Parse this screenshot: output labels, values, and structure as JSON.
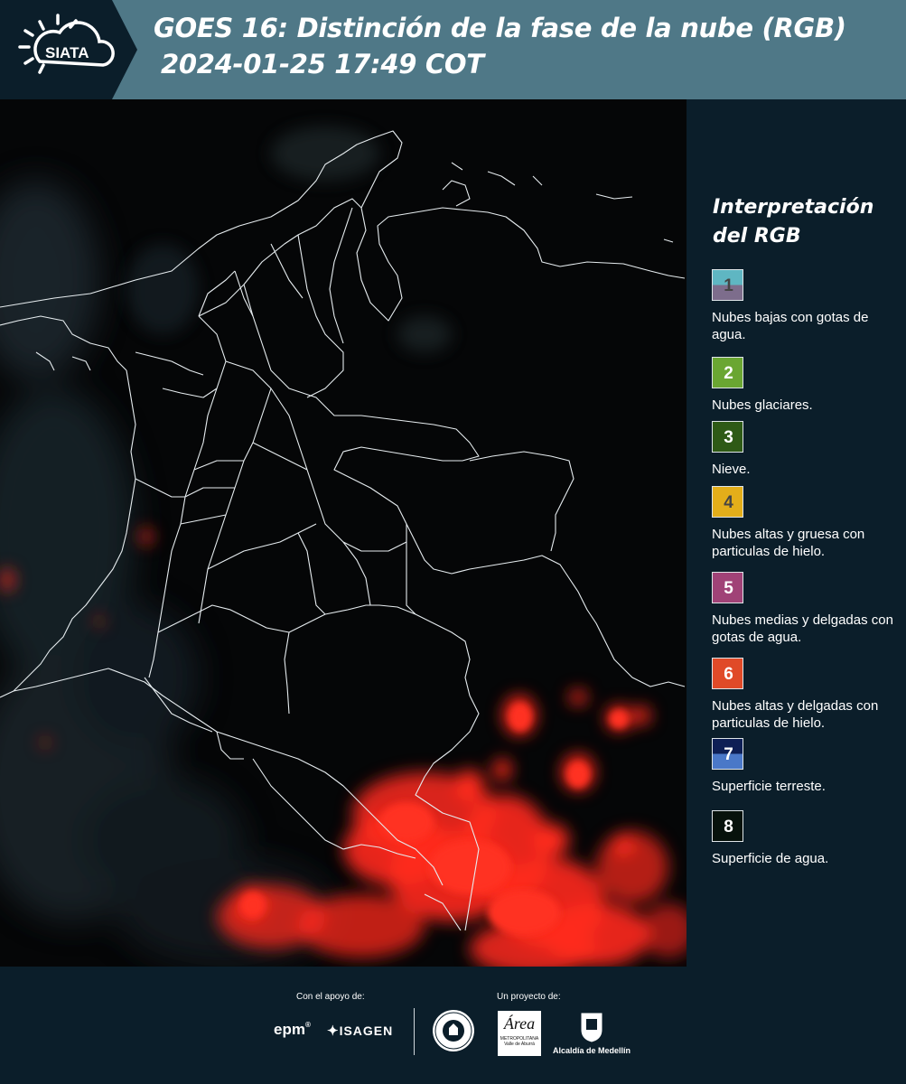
{
  "header": {
    "logo_text": "SIATA",
    "title_line1": "GOES 16: Distinción de la fase de la nube (RGB)",
    "title_line2": "2024-01-25 17:49 COT"
  },
  "legend": {
    "title": "Interpretación del RGB",
    "items": [
      {
        "num": "1",
        "label": "Nubes bajas con gotas de agua.",
        "color_top": "#5fb6c2",
        "color_bottom": "#7d6d8c",
        "num_color": "#444444"
      },
      {
        "num": "2",
        "label": "Nubes glaciares.",
        "color_top": "#6aa632",
        "color_bottom": "#6aa632",
        "num_color": "#ffffff"
      },
      {
        "num": "3",
        "label": "Nieve.",
        "color_top": "#2e5a16",
        "color_bottom": "#2e5a16",
        "num_color": "#ffffff"
      },
      {
        "num": "4",
        "label": "Nubes altas y gruesa con particulas de hielo.",
        "color_top": "#e3ae1a",
        "color_bottom": "#e3ae1a",
        "num_color": "#444444"
      },
      {
        "num": "5",
        "label": "Nubes medias y delgadas con gotas de agua.",
        "color_top": "#a04277",
        "color_bottom": "#a04277",
        "num_color": "#ffffff"
      },
      {
        "num": "6",
        "label": "Nubes altas y delgadas con particulas de hielo.",
        "color_top": "#e04a28",
        "color_bottom": "#e04a28",
        "num_color": "#ffffff"
      },
      {
        "num": "7",
        "label": "Superficie terreste.",
        "color_top": "#0e1f55",
        "color_bottom": "#4a78c8",
        "num_color": "#ffffff"
      },
      {
        "num": "8",
        "label": "Superficie de agua.",
        "color_top": "#07120c",
        "color_bottom": "#07120c",
        "num_color": "#ffffff"
      }
    ]
  },
  "footer": {
    "support_label": "Con el apoyo de:",
    "project_label": "Un proyecto de:",
    "epm": "epm",
    "isagen": "ISAGEN",
    "area_word": "Área",
    "area_sub": "METROPOLITANA",
    "area_sub2": "Valle de Aburrá",
    "alcaldia": "Alcaldía de Medellín"
  },
  "colors": {
    "header_bg": "#4f7887",
    "panel_bg": "#0b1e2a",
    "cloud_red": "#ff2a1e",
    "boundary": "#e6ecef"
  }
}
